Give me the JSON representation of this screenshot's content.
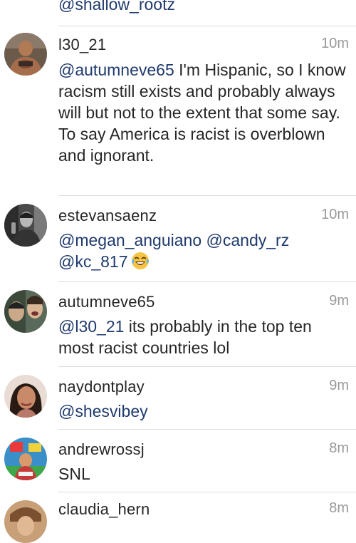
{
  "top_fragment": "@shallow_rootz",
  "comments": [
    {
      "username": "l30_21",
      "time": "10m",
      "mentions": [
        "@autumneve65"
      ],
      "text": " I'm Hispanic, so I know racism still exists and probably always will but not to the extent that some say. To say America is racist is overblown and ignorant."
    },
    {
      "username": "estevansaenz",
      "time": "10m",
      "mentions": [
        "@megan_anguiano",
        "@candy_rz",
        "@kc_817"
      ],
      "emoji": "face-with-tears-of-joy"
    },
    {
      "username": "autumneve65",
      "time": "9m",
      "mentions": [
        "@l30_21"
      ],
      "text": " its probably in the top ten most racist countries lol"
    },
    {
      "username": "naydontplay",
      "time": "9m",
      "mentions": [
        "@shesvibey"
      ]
    },
    {
      "username": "andrewrossj",
      "time": "8m",
      "text": "SNL"
    },
    {
      "username": "claudia_hern",
      "time": "8m"
    }
  ],
  "colors": {
    "mention": "#1f3a6d",
    "text": "#262626",
    "time": "#999999",
    "divider": "#dcdcdc"
  }
}
